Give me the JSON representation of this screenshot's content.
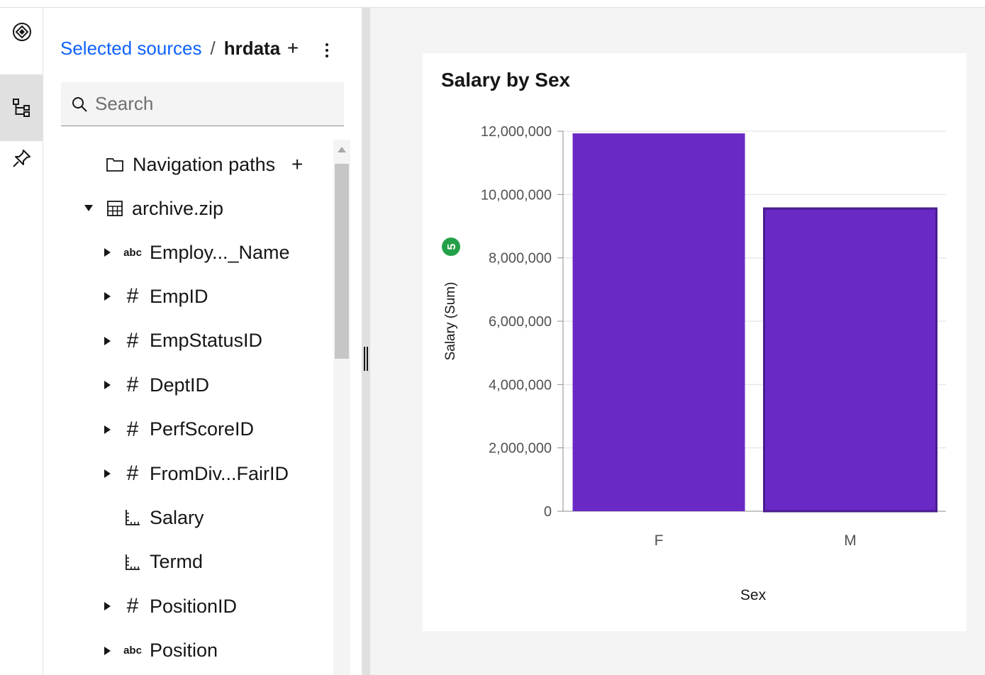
{
  "rail": {
    "items": [
      {
        "icon": "assistant-icon",
        "selected": false
      },
      {
        "icon": "data-tree-icon",
        "selected": true
      },
      {
        "icon": "pin-icon",
        "selected": false
      }
    ]
  },
  "sources": {
    "breadcrumb_link": "Selected sources",
    "breadcrumb_sep": "/",
    "breadcrumb_current": "hrdata",
    "add_label": "+",
    "search_placeholder": "Search"
  },
  "tree": {
    "nav_paths_label": "Navigation paths",
    "nav_paths_add": "+",
    "source_label": "archive.zip",
    "fields": [
      {
        "type_label": "abc",
        "label": "Employ..._Name",
        "expandable": true,
        "kind": "text"
      },
      {
        "type_label": "#",
        "label": "EmpID",
        "expandable": true,
        "kind": "number"
      },
      {
        "type_label": "#",
        "label": "EmpStatusID",
        "expandable": true,
        "kind": "number"
      },
      {
        "type_label": "#",
        "label": "DeptID",
        "expandable": true,
        "kind": "number"
      },
      {
        "type_label": "#",
        "label": "PerfScoreID",
        "expandable": true,
        "kind": "number"
      },
      {
        "type_label": "#",
        "label": "FromDiv...FairID",
        "expandable": true,
        "kind": "number"
      },
      {
        "type_label": "",
        "label": "Salary",
        "expandable": false,
        "kind": "measure"
      },
      {
        "type_label": "",
        "label": "Termd",
        "expandable": false,
        "kind": "measure"
      },
      {
        "type_label": "#",
        "label": "PositionID",
        "expandable": true,
        "kind": "number"
      },
      {
        "type_label": "abc",
        "label": "Position",
        "expandable": true,
        "kind": "text"
      }
    ]
  },
  "chart_data": {
    "type": "bar",
    "title": "Salary by Sex",
    "xlabel": "Sex",
    "ylabel": "Salary (Sum)",
    "badge": "5",
    "categories": [
      "F",
      "M"
    ],
    "values": [
      11930000,
      9560000
    ],
    "ylim": [
      0,
      12000000
    ],
    "yticks": [
      "0",
      "2,000,000",
      "4,000,000",
      "6,000,000",
      "8,000,000",
      "10,000,000",
      "12,000,000"
    ],
    "ytick_values": [
      0,
      2000000,
      4000000,
      6000000,
      8000000,
      10000000,
      12000000
    ],
    "grid": true,
    "bar_color": "#6929c4",
    "badge_color": "#24a148"
  }
}
